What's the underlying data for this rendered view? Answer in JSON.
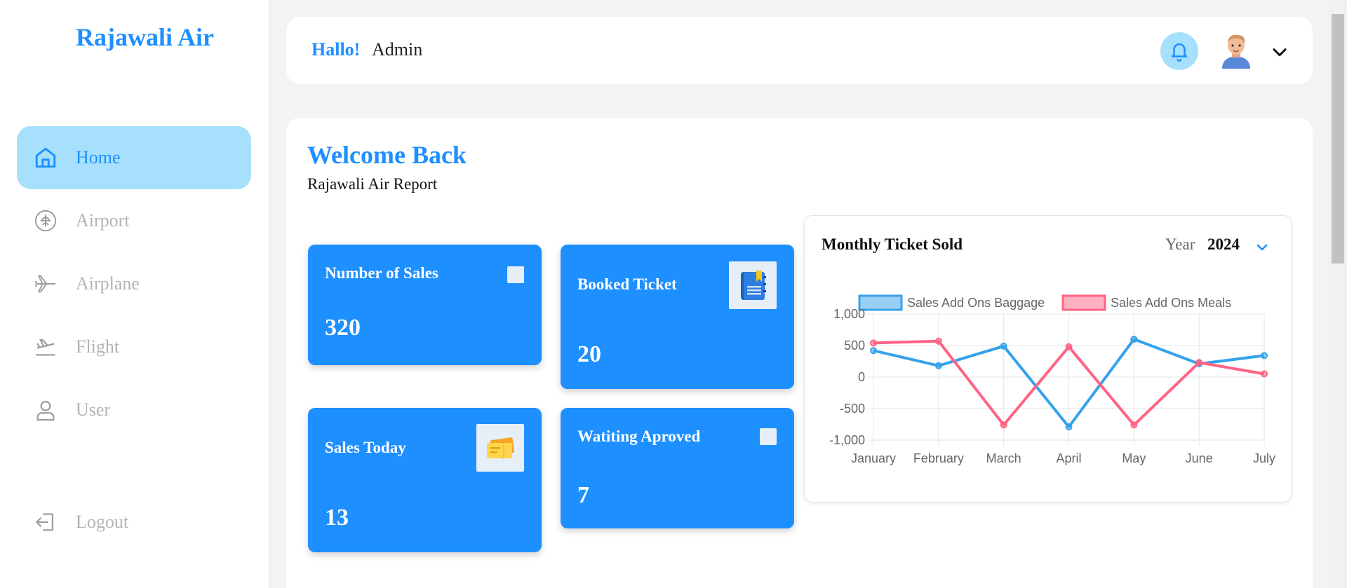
{
  "sidebar": {
    "brand": "Rajawali Air",
    "items": [
      {
        "label": "Home",
        "icon": "home-icon"
      },
      {
        "label": "Airport",
        "icon": "airport-icon"
      },
      {
        "label": "Airplane",
        "icon": "airplane-icon"
      },
      {
        "label": "Flight",
        "icon": "flight-departure-icon"
      },
      {
        "label": "User",
        "icon": "user-icon"
      }
    ],
    "logout": {
      "label": "Logout",
      "icon": "logout-icon"
    }
  },
  "header": {
    "greeting": "Hallo!",
    "username": "Admin"
  },
  "main": {
    "welcome": "Welcome Back",
    "subtitle": "Rajawali Air Report",
    "cards": [
      {
        "title": "Number of Sales",
        "value": "320"
      },
      {
        "title": "Booked Ticket",
        "value": "20"
      },
      {
        "title": "Sales Today",
        "value": "13"
      },
      {
        "title": "Watiting Aproved",
        "value": "7"
      }
    ]
  },
  "chart": {
    "title": "Monthly Ticket Sold",
    "year_label": "Year",
    "year_value": "2024"
  },
  "colors": {
    "accent": "#1e8fff",
    "active_bg": "#a6e0fc",
    "series_baggage": "#36a2eb",
    "series_meals": "#ff6384"
  },
  "chart_data": {
    "type": "line",
    "categories": [
      "January",
      "February",
      "March",
      "April",
      "May",
      "June",
      "July"
    ],
    "series": [
      {
        "name": "Sales Add Ons Baggage",
        "values": [
          420,
          180,
          490,
          -790,
          600,
          210,
          340
        ]
      },
      {
        "name": "Sales Add Ons Meals",
        "values": [
          540,
          570,
          -760,
          480,
          -760,
          230,
          50
        ]
      }
    ],
    "ylim": [
      -1000,
      1000
    ],
    "yticks": [
      "1,000",
      "500",
      "0",
      "-500",
      "-1,000"
    ],
    "legend": "top",
    "grid": true
  }
}
